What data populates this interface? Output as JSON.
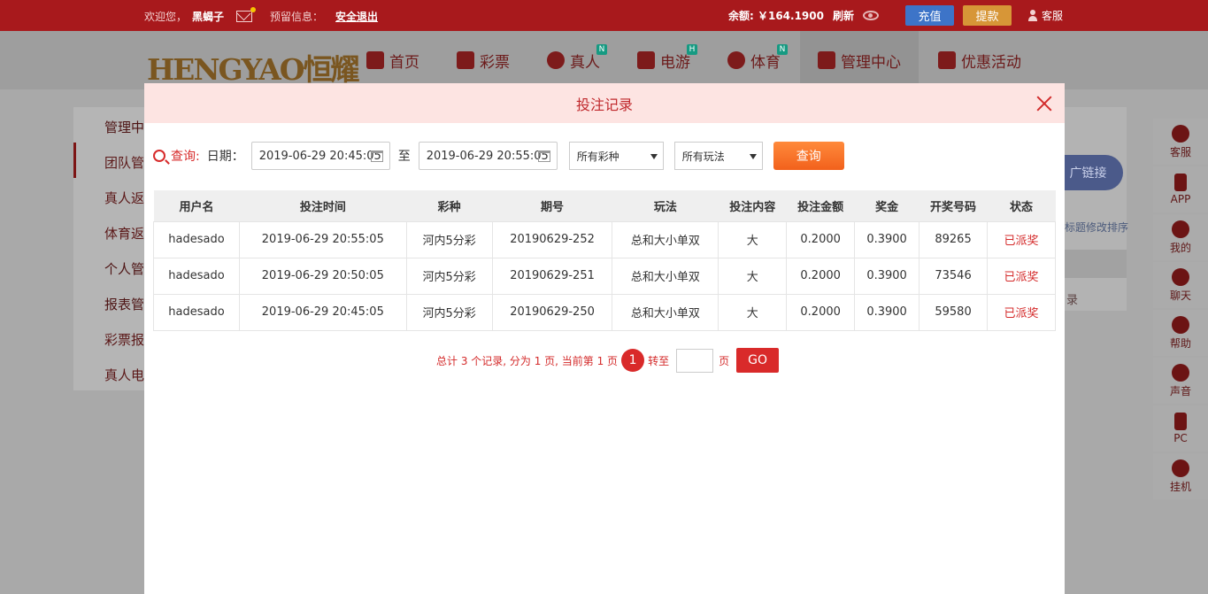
{
  "topbar": {
    "welcome": "欢迎您，",
    "username": "黑蝎子",
    "reserved": "预留信息：",
    "logout": "安全退出",
    "balance_label": "余额: ￥164.1900",
    "refresh": "刷新",
    "recharge": "充值",
    "withdraw": "提款",
    "service": "客服"
  },
  "logo": "HENGYAO恒耀",
  "nav": [
    "首页",
    "彩票",
    "真人",
    "电游",
    "体育",
    "管理中心",
    "优惠活动"
  ],
  "nav_badges": {
    "zhenren": "N",
    "dianyou": "H",
    "tiyu": "N"
  },
  "sidebar": [
    "管理中",
    "团队管",
    "真人返",
    "体育返",
    "个人管",
    "报表管",
    "彩票报",
    "真人电"
  ],
  "right_bg": {
    "promo": "广链接",
    "hint": "标题修改排序",
    "link": "录"
  },
  "toolbar": [
    "客服",
    "APP",
    "我的",
    "聊天",
    "帮助",
    "声音",
    "PC",
    "挂机"
  ],
  "modal": {
    "title": "投注记录",
    "query_label": "查询:",
    "date_label": "日期：",
    "date_from": "2019-06-29 20:45:05",
    "to_label": "至",
    "date_to": "2019-06-29 20:55:05",
    "lottery_select": "所有彩种",
    "play_select": "所有玩法",
    "query_button": "查询"
  },
  "table": {
    "headers": [
      "用户名",
      "投注时间",
      "彩种",
      "期号",
      "玩法",
      "投注内容",
      "投注金额",
      "奖金",
      "开奖号码",
      "状态"
    ],
    "rows": [
      [
        "hadesado",
        "2019-06-29 20:55:05",
        "河内5分彩",
        "20190629-252",
        "总和大小单双",
        "大",
        "0.2000",
        "0.3900",
        "89265",
        "已派奖"
      ],
      [
        "hadesado",
        "2019-06-29 20:50:05",
        "河内5分彩",
        "20190629-251",
        "总和大小单双",
        "大",
        "0.2000",
        "0.3900",
        "73546",
        "已派奖"
      ],
      [
        "hadesado",
        "2019-06-29 20:45:05",
        "河内5分彩",
        "20190629-250",
        "总和大小单双",
        "大",
        "0.2000",
        "0.3900",
        "59580",
        "已派奖"
      ]
    ]
  },
  "pager": {
    "summary": "总计 3 个记录, 分为 1 页, 当前第 1 页",
    "current": "1",
    "goto": "转至",
    "page_unit": "页",
    "go": "GO"
  },
  "colors": {
    "accent": "#d92a2a",
    "topbar": "#a8191c",
    "modal_head": "#fde4e2",
    "query_btn": "#f2611c"
  }
}
